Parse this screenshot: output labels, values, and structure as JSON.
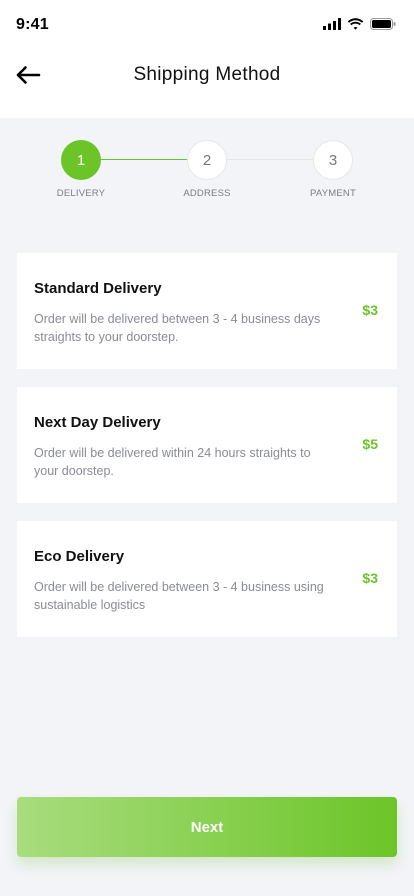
{
  "status_bar": {
    "time": "9:41",
    "icons": [
      "signal-icon",
      "wifi-icon",
      "battery-icon"
    ]
  },
  "header": {
    "back_icon": "arrow-left-icon",
    "title": "Shipping Method"
  },
  "stepper": {
    "active_color": "#6cc528",
    "steps": [
      {
        "number": "1",
        "label": "DELIVERY",
        "active": true
      },
      {
        "number": "2",
        "label": "ADDRESS",
        "active": false
      },
      {
        "number": "3",
        "label": "PAYMENT",
        "active": false
      }
    ]
  },
  "options": [
    {
      "title": "Standard Delivery",
      "description": "Order will be delivered between 3 - 4 business days straights to your doorstep.",
      "price": "$3"
    },
    {
      "title": "Next Day Delivery",
      "description": "Order will be delivered within 24 hours straights to your doorstep.",
      "price": "$5"
    },
    {
      "title": "Eco Delivery",
      "description": "Order will be delivered between 3 - 4 business using sustainable logistics",
      "price": "$3"
    }
  ],
  "footer": {
    "next_label": "Next"
  }
}
